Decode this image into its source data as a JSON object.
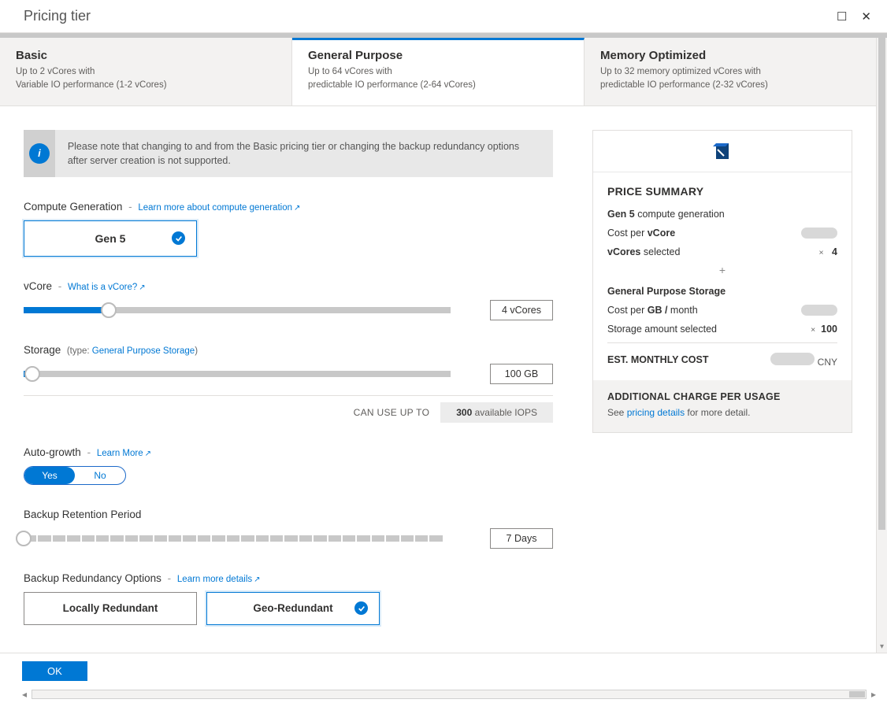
{
  "title": "Pricing tier",
  "tabs": {
    "basic": {
      "title": "Basic",
      "line1": "Up to 2 vCores with",
      "line2": "Variable IO performance (1-2 vCores)"
    },
    "general": {
      "title": "General Purpose",
      "line1": "Up to 64 vCores with",
      "line2": "predictable IO performance (2-64 vCores)"
    },
    "memory": {
      "title": "Memory Optimized",
      "line1": "Up to 32 memory optimized vCores with",
      "line2": "predictable IO performance (2-32 vCores)"
    }
  },
  "info": "Please note that changing to and from the Basic pricing tier or changing the backup redundancy options after server creation is not supported.",
  "compute": {
    "label": "Compute Generation",
    "link": "Learn more about compute generation",
    "option": "Gen 5"
  },
  "vcore": {
    "label": "vCore",
    "link": "What is a vCore?",
    "value": "4 vCores"
  },
  "storage": {
    "label": "Storage",
    "typePrefix": "(type:",
    "type": "General Purpose Storage",
    "typeSuffix": ")",
    "value": "100 GB",
    "iopsLabel": "CAN USE UP TO",
    "iopsBold": "300",
    "iopsRest": "available IOPS"
  },
  "autogrowth": {
    "label": "Auto-growth",
    "link": "Learn More",
    "yes": "Yes",
    "no": "No"
  },
  "retention": {
    "label": "Backup Retention Period",
    "value": "7 Days"
  },
  "redundancy": {
    "label": "Backup Redundancy Options",
    "link": "Learn more details",
    "local": "Locally Redundant",
    "geo": "Geo-Redundant"
  },
  "summary": {
    "title": "PRICE SUMMARY",
    "genBold": "Gen 5",
    "genRest": "compute generation",
    "costVcoreA": "Cost per",
    "costVcoreB": "vCore",
    "vcSelA": "vCores",
    "vcSelB": "selected",
    "vcMul": "×",
    "vcVal": "4",
    "storageHead": "General Purpose Storage",
    "costGbA": "Cost per",
    "costGbB": "GB /",
    "costGbC": "month",
    "stSelA": "Storage amount selected",
    "stMul": "×",
    "stVal": "100",
    "est": "EST. MONTHLY COST",
    "cur": "CNY",
    "footTitle": "ADDITIONAL CHARGE PER USAGE",
    "footA": "See",
    "footLink": "pricing details",
    "footB": "for more detail."
  },
  "ok": "OK"
}
